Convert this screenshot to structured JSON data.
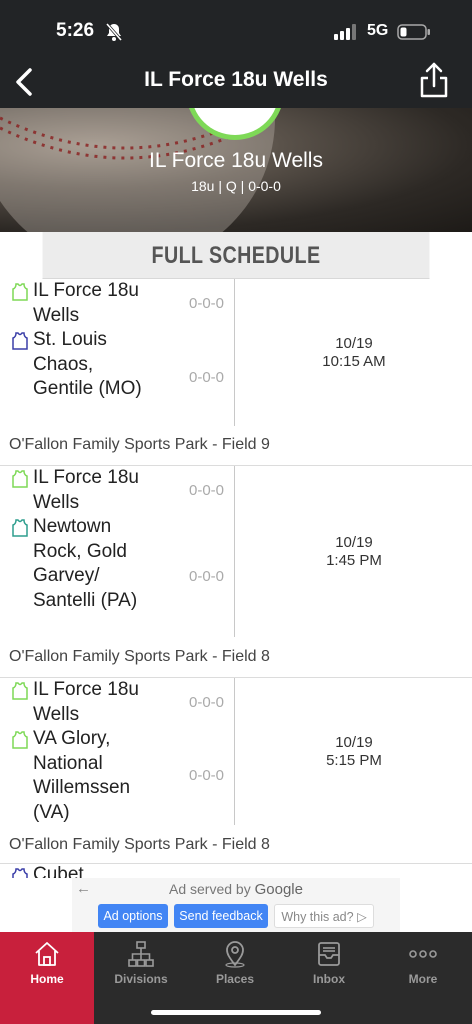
{
  "status": {
    "time": "5:26",
    "network": "5G"
  },
  "nav": {
    "title": "IL Force 18u Wells"
  },
  "hero": {
    "title": "IL Force 18u Wells",
    "subtitle": "18u | Q | 0-0-0"
  },
  "schedule": {
    "header": "FULL SCHEDULE"
  },
  "games": [
    {
      "team1": {
        "name": "IL Force 18u Wells",
        "score": "0-0-0",
        "icon_color": "#7ed957"
      },
      "team2": {
        "name": "St. Louis Chaos, Gentile (MO)",
        "score": "0-0-0",
        "icon_color": "#3b3fa8"
      },
      "date": "10/19",
      "time": "10:15 AM",
      "venue": "O'Fallon Family Sports Park - Field 9"
    },
    {
      "team1": {
        "name": "IL Force 18u Wells",
        "score": "0-0-0",
        "icon_color": "#7ed957"
      },
      "team2": {
        "name": "Newtown Rock, Gold Garvey/ Santelli (PA)",
        "score": "0-0-0",
        "icon_color": "#2f9e8e"
      },
      "date": "10/19",
      "time": "1:45 PM",
      "venue": "O'Fallon Family Sports Park - Field 8"
    },
    {
      "team1": {
        "name": "IL Force 18u Wells",
        "score": "0-0-0",
        "icon_color": "#7ed957"
      },
      "team2": {
        "name": "VA Glory, National Willemssen (VA)",
        "score": "0-0-0",
        "icon_color": "#7ed957"
      },
      "date": "10/19",
      "time": "5:15 PM",
      "venue": "O'Fallon Family Sports Park - Field 8"
    }
  ],
  "peek": {
    "name": "Cubet"
  },
  "ad": {
    "served_by": "Ad served by",
    "brand": "Google",
    "options_label": "Ad options",
    "feedback_label": "Send feedback",
    "why_label": "Why this ad?"
  },
  "tabs": [
    {
      "label": "Home",
      "icon": "home-icon",
      "active": true
    },
    {
      "label": "Divisions",
      "icon": "hierarchy-icon",
      "active": false
    },
    {
      "label": "Places",
      "icon": "map-pin-icon",
      "active": false
    },
    {
      "label": "Inbox",
      "icon": "inbox-icon",
      "active": false
    },
    {
      "label": "More",
      "icon": "more-dots-icon",
      "active": false
    }
  ],
  "colors": {
    "accent": "#c8203c",
    "topbar": "#222426",
    "tabbar": "#2b2b2b",
    "team_green": "#7ed957"
  }
}
